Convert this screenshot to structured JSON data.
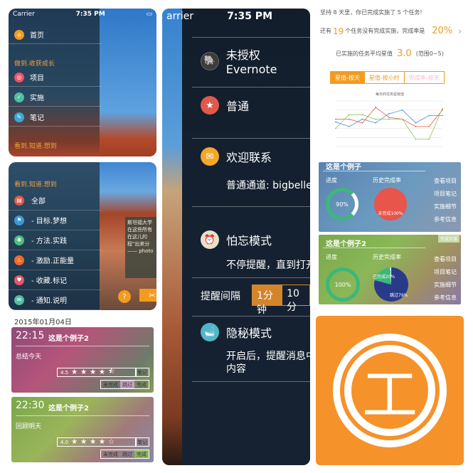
{
  "panelA": {
    "status": {
      "carrier": "Carrier",
      "time": "7:35 PM"
    },
    "home": "首页",
    "section1": "做到.收获成长",
    "items": [
      "项目",
      "实施",
      "笔记"
    ],
    "section2": "看到.知道.想到"
  },
  "panelB": {
    "section": "看到.知道.想到",
    "items": [
      "全部",
      "- 目标.梦想",
      "- 方法.实践",
      "- 激励.正能量",
      "- 收藏.标记",
      "- 通知.说明"
    ],
    "tooltip": "斯坦福大学 在这些所有 在这儿的 程\"出来分 —— photo",
    "help": "?",
    "scissor": "✂"
  },
  "panelC": {
    "date": "2015年01月04日",
    "cards": [
      {
        "time": "22:15",
        "title": "这是个例子2",
        "summary": "总结今天",
        "score": "4.5",
        "note": "笔记",
        "seg": [
          "未完成",
          "跳过",
          "完成"
        ]
      },
      {
        "time": "22:30",
        "title": "这是个例子2",
        "summary": "回顾明天",
        "score": "4.0",
        "note": "笔记",
        "seg": [
          "未完成",
          "跳过",
          "完成"
        ]
      }
    ]
  },
  "panelD": {
    "status": {
      "carrier": "arrier",
      "time": "7:35 PM"
    },
    "evernote": "未授权Evernote",
    "normal": "普通",
    "welcome": "欢迎联系",
    "welcome_sub": "普通通道: bigbelle",
    "forget": "怕忘模式",
    "forget_sub": "不停提醒，直到打开",
    "interval_label": "提醒间隔",
    "interval_opts": [
      "1分钟",
      "10分"
    ],
    "private": "隐秘模式",
    "private_sub1": "开启后，提醒消息中",
    "private_sub2": "内容"
  },
  "panelE": {
    "line1": "坚持 8 天里，你已完成实施了 5 个任务!",
    "line2_a": "还有",
    "line2_num": "19",
    "line2_b": "个任务没有完成实施，完成率是",
    "line2_rate": "20%",
    "avg_label": "已实施的任务平均星值",
    "avg_value": "3.0",
    "avg_range": "(范围0~5)",
    "tabs": [
      "星值-按天",
      "星值-按小时",
      "完成率-按天"
    ],
    "chart_title": "每日的任务星级值"
  },
  "panelF": {
    "cards": [
      {
        "title": "这是个例子",
        "progress": "进度",
        "history": "历史完成率",
        "pct": "90%",
        "pie_label": "未完成100%",
        "links": [
          "查看项目",
          "项目笔记",
          "实施细节",
          "参考信息"
        ]
      },
      {
        "title": "这是个例子2",
        "progress": "进度",
        "history": "历史完成率",
        "pct": "100%",
        "pie_done": "已完成20%",
        "pie_skip": "跳过79%",
        "badge": "完成实施",
        "links": [
          "查看项目",
          "项目笔记",
          "实施细节",
          "参考信息"
        ]
      }
    ]
  },
  "panelG": {
    "glyph": "工"
  },
  "chart_data": {
    "type": "line",
    "title": "每日的任务星级值",
    "series": [
      {
        "values": [
          3.0,
          3.0,
          2.6,
          4.3,
          3.2,
          3.0,
          2.2,
          2.2,
          4.0
        ]
      },
      {
        "values": [
          2.7,
          2.2,
          3.0,
          2.6,
          3.6,
          4.0,
          2.6,
          3.4,
          3.4
        ]
      },
      {
        "values": [
          2.0,
          3.5,
          3.5,
          3.0,
          3.0,
          3.0,
          0.8,
          0.8,
          4.2
        ]
      }
    ]
  }
}
